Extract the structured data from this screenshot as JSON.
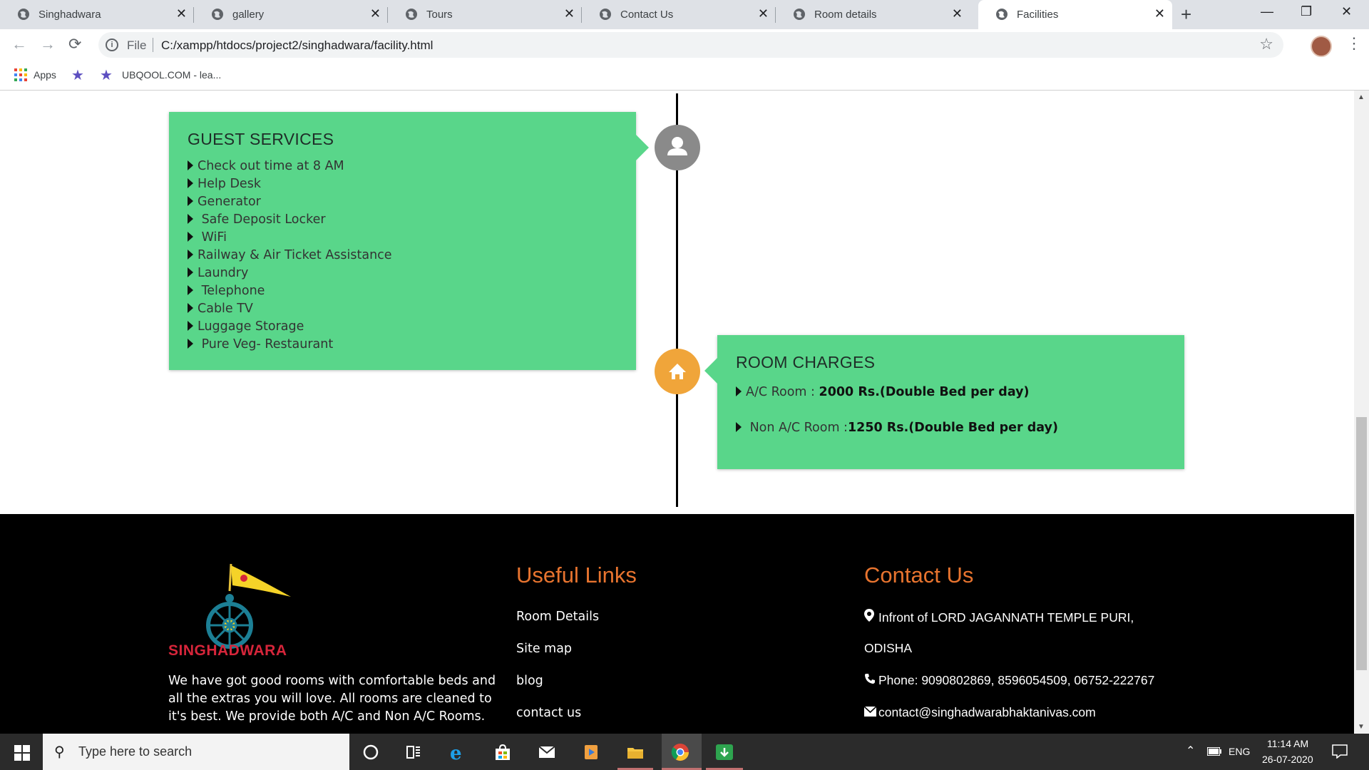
{
  "browser": {
    "tabs": [
      {
        "title": "Singhadwara",
        "close": "✕"
      },
      {
        "title": "gallery",
        "close": "✕"
      },
      {
        "title": "Tours",
        "close": "✕"
      },
      {
        "title": "Contact Us",
        "close": "✕"
      },
      {
        "title": "Room details",
        "close": "✕"
      },
      {
        "title": "Facilities",
        "close": "✕",
        "active": true
      }
    ],
    "new_tab": "+",
    "window_controls": {
      "minimize": "—",
      "restore": "❐",
      "close": "✕"
    },
    "nav": {
      "back": "←",
      "forward": "→",
      "reload": "⟳"
    },
    "address": {
      "scheme_label": "File",
      "url": "C:/xampp/htdocs/project2/singhadwara/facility.html",
      "bookmark_star": "☆"
    },
    "menu": "⋮",
    "bookmarks": [
      {
        "label": "Apps"
      },
      {
        "label": "UBQOOL.COM - lea..."
      }
    ],
    "bookmark_icon": "★"
  },
  "guest_services": {
    "title": "GUEST SERVICES",
    "items": [
      "Check out time at 8 AM",
      "Help Desk",
      "Generator",
      " Safe Deposit Locker",
      " WiFi",
      "Railway & Air Ticket Assistance",
      "Laundry",
      " Telephone",
      "Cable TV",
      "Luggage Storage",
      " Pure Veg- Restaurant"
    ],
    "icon": "user-icon",
    "icon_bg": "#8a8a8a"
  },
  "room_charges": {
    "title": "ROOM CHARGES",
    "rows": [
      {
        "label": "A/C Room : ",
        "value": "2000 Rs.(Double Bed per day)"
      },
      {
        "label": " Non A/C Room :",
        "value": "1250 Rs.(Double Bed per day)"
      }
    ],
    "icon": "home-icon",
    "icon_bg": "#f0a53a"
  },
  "card_color": "#59d68a",
  "footer": {
    "logo_text": "SINGHADWARA",
    "about": "We have got good rooms with comfortable beds and all the extras you will love. All rooms are cleaned to it's best. We provide both A/C and Non A/C Rooms.",
    "useful_links": {
      "heading": "Useful Links",
      "items": [
        "Room Details",
        "Site map",
        "blog",
        "contact us"
      ]
    },
    "contact": {
      "heading": "Contact Us",
      "address_line1": "Infront of LORD JAGANNATH TEMPLE PURI,",
      "address_line2": "ODISHA",
      "phone": "Phone: 9090802869, 8596054509, 06752-222767",
      "email": "contact@singhadwarabhaktanivas.com"
    },
    "heading_color": "#e8742f"
  },
  "taskbar": {
    "search_placeholder": "Type here to search",
    "tray": {
      "lang": "ENG",
      "time": "11:14 AM",
      "date": "26-07-2020"
    }
  }
}
